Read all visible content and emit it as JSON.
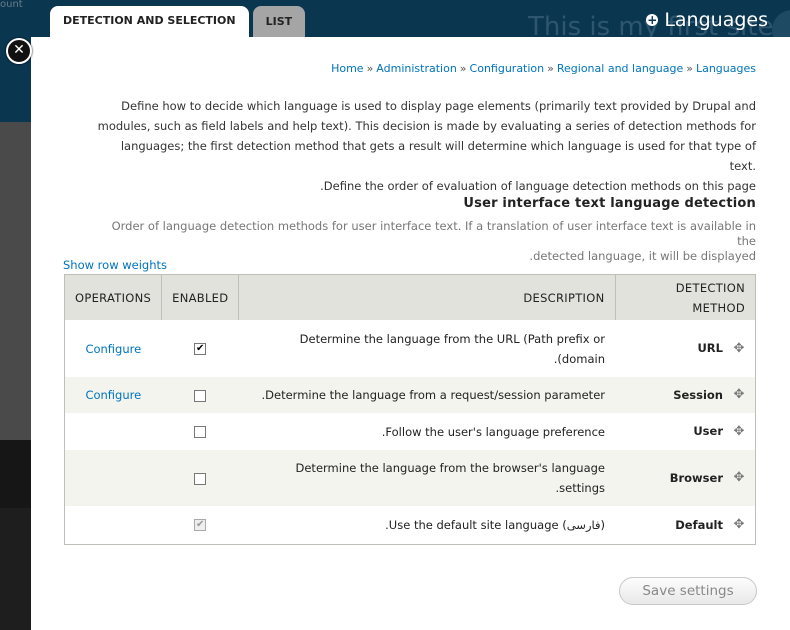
{
  "background": {
    "count_text": "ount",
    "site_title": "This is my first site"
  },
  "tabs": [
    {
      "label": "DETECTION AND SELECTION",
      "active": true
    },
    {
      "label": "LIST",
      "active": false
    }
  ],
  "overlay_title": "Languages",
  "breadcrumb": [
    "Home",
    "Administration",
    "Configuration",
    "Regional and language",
    "Languages"
  ],
  "breadcrumb_separator": "»",
  "intro_lines": [
    "Define how to decide which language is used to display page elements (primarily text provided by Drupal and",
    "modules, such as field labels and help text). This decision is made by evaluating a series of detection methods for",
    "languages; the first detection method that gets a result will determine which language is used for that type of text.",
    ".Define the order of evaluation of language detection methods on this page"
  ],
  "section_title": "User interface text language detection",
  "section_desc_lines": [
    "Order of language detection methods for user interface text. If a translation of user interface text is available in the",
    ".detected language, it will be displayed"
  ],
  "show_row_weights": "Show row weights",
  "table": {
    "headers": {
      "operations": "OPERATIONS",
      "enabled": "ENABLED",
      "description": "DESCRIPTION",
      "method_line1": "DETECTION",
      "method_line2": "METHOD"
    },
    "rows": [
      {
        "operation": "Configure",
        "enabled": true,
        "disabled": false,
        "desc1": "Determine the language from the URL (Path prefix or",
        "desc2": ".(domain",
        "method": "URL"
      },
      {
        "operation": "Configure",
        "enabled": false,
        "disabled": false,
        "desc1": ".Determine the language from a request/session parameter",
        "desc2": "",
        "method": "Session"
      },
      {
        "operation": "",
        "enabled": false,
        "disabled": false,
        "desc1": ".Follow the user's language preference",
        "desc2": "",
        "method": "User"
      },
      {
        "operation": "",
        "enabled": false,
        "disabled": false,
        "desc1": "Determine the language from the browser's language",
        "desc2": ".settings",
        "method": "Browser"
      },
      {
        "operation": "",
        "enabled": true,
        "disabled": true,
        "desc1": ".Use the default site language (فارسی)",
        "desc2": "",
        "method": "Default"
      }
    ]
  },
  "save_button": "Save settings",
  "icons": {
    "close": "close-icon",
    "plus": "plus-circle-icon",
    "drag": "drag-handle-icon"
  }
}
